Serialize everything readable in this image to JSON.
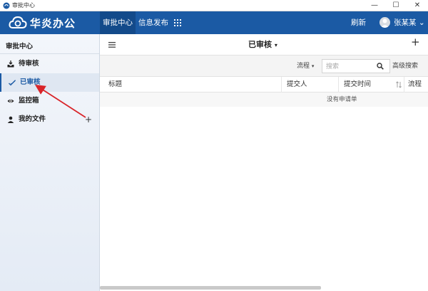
{
  "window": {
    "title": "审批中心",
    "minimize": "—",
    "maximize": "☐",
    "close": "✕"
  },
  "header": {
    "logo_text": "华炎办公",
    "tabs": [
      {
        "label": "审批中心",
        "active": true
      },
      {
        "label": "信息发布",
        "active": false
      }
    ],
    "grid_icon": "apps-grid-icon",
    "refresh_label": "刷新",
    "user_name": "张某某"
  },
  "sidebar": {
    "title": "审批中心",
    "items": [
      {
        "label": "待审核",
        "icon": "inbox-icon",
        "active": false
      },
      {
        "label": "已审核",
        "icon": "check-icon",
        "active": true
      },
      {
        "label": "监控箱",
        "icon": "eye-icon",
        "active": false
      },
      {
        "label": "我的文件",
        "icon": "user-icon",
        "active": false,
        "plus": "+"
      }
    ]
  },
  "main": {
    "title": "已审核",
    "add_label": "+",
    "filter": {
      "flow_label": "流程",
      "search_placeholder": "搜索",
      "advanced_label": "高级搜索"
    },
    "columns": [
      "标题",
      "提交人",
      "提交时间",
      "流程"
    ],
    "empty_text": "没有申请单"
  },
  "colors": {
    "header_bg": "#1b5aa4",
    "accent": "#1b5aa4",
    "annotation_arrow": "#d9252a"
  }
}
